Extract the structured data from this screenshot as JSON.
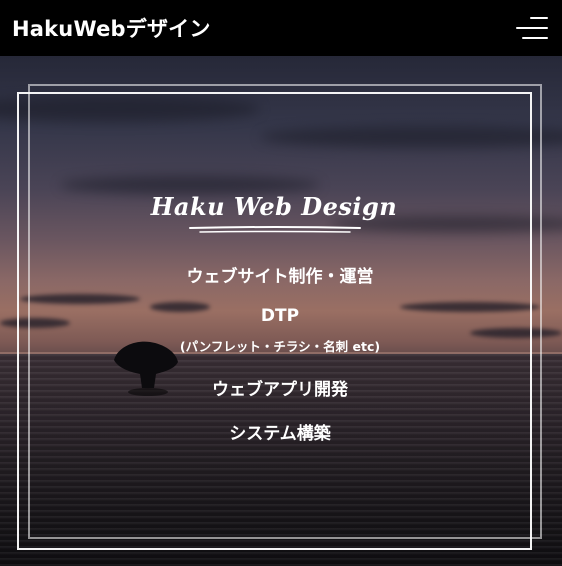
{
  "header": {
    "site_title": "HakuWebデザイン",
    "menu_icon": "hamburger-menu-icon"
  },
  "hero": {
    "logo_text": "Haku Web Design",
    "services": [
      {
        "label": "ウェブサイト制作・運営"
      },
      {
        "label": "DTP",
        "sub": "(パンフレット・チラシ・名刺 etc)"
      },
      {
        "label": "ウェブアプリ開発"
      },
      {
        "label": "システム構築"
      }
    ]
  },
  "colors": {
    "header_bg": "#000000",
    "text": "#ffffff",
    "frame": "#ffffff"
  }
}
